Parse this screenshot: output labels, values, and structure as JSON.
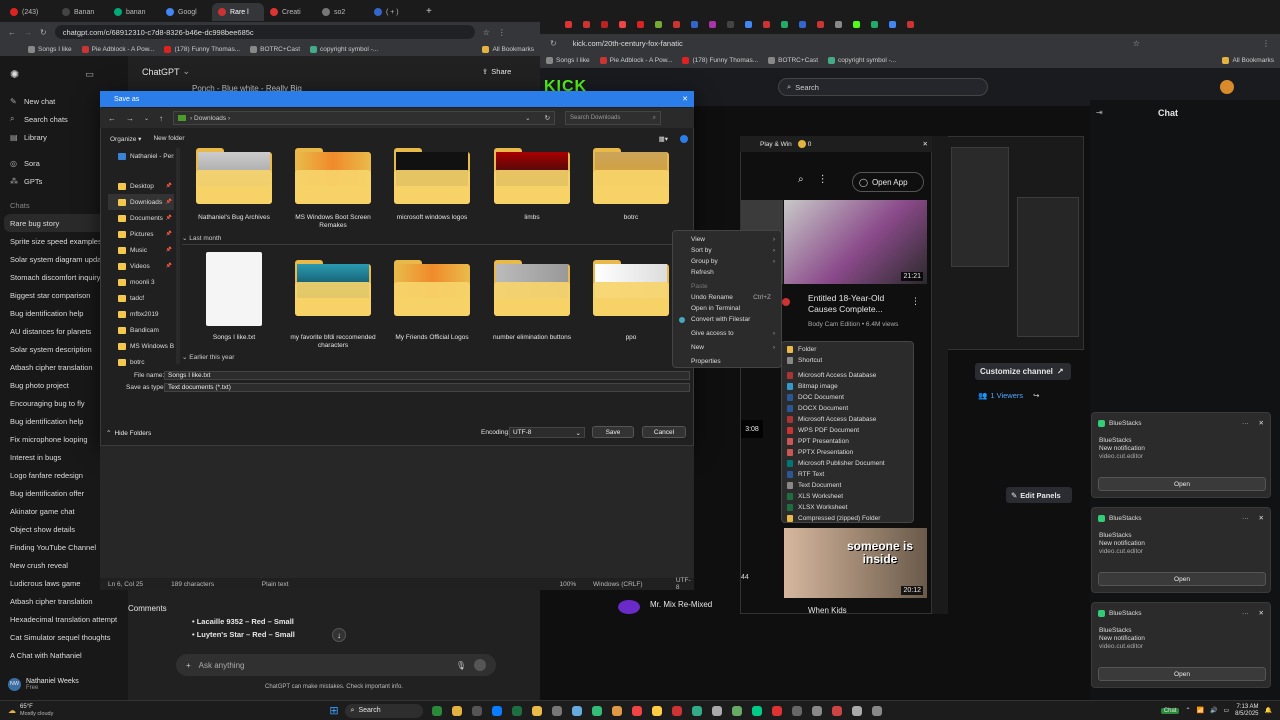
{
  "left_browser": {
    "tabs": [
      "(243)",
      "Banan",
      "banan",
      "Googl",
      "Rare l",
      "Creati",
      "so2",
      "( + )"
    ],
    "url": "chatgpt.com/c/68912310-c7d8-8326-b46e-dc998bee685c",
    "bookmarks": [
      "Songs I like",
      "Pie Adblock - A Pow...",
      "(178) Funny Thomas...",
      "BOTRC+Cast",
      "copyright symbol -..."
    ],
    "all_bookmarks": "All Bookmarks"
  },
  "gpt": {
    "app_title": "ChatGPT",
    "share": "Share",
    "behind_title": "Ponch - Blue white - Really Big",
    "new_chat": "New chat",
    "search_chats": "Search chats",
    "library": "Library",
    "sora": "Sora",
    "gpts": "GPTs",
    "chats_header": "Chats",
    "chats": [
      "Rare bug story",
      "Sprite size speed examples",
      "Solar system diagram updat",
      "Stomach discomfort inquiry",
      "Biggest star comparison",
      "Bug identification help",
      "AU distances for planets",
      "Solar system description",
      "Atbash cipher translation",
      "Bug photo project",
      "Encouraging bug to fly",
      "Bug identification help",
      "Fix microphone looping",
      "Interest in bugs",
      "Logo fanfare redesign",
      "Bug identification offer",
      "Akinator game chat",
      "Object show details",
      "Finding YouTube Channel",
      "New crush reveal",
      "Ludicrous laws game",
      "Atbash cipher translation",
      "Hexadecimal translation attempt",
      "Cat Simulator sequel thoughts",
      "A Chat with Nathaniel"
    ],
    "user_name": "Nathaniel Weeks",
    "user_plan": "Free",
    "user_initials": "NW",
    "comments_label": "Comments",
    "bullets": [
      "Lacaille 9352 – Red – Small",
      "Luyten's Star – Red – Small"
    ],
    "ask_placeholder": "Ask anything",
    "disclaimer": "ChatGPT can make mistakes. Check important info."
  },
  "right_browser": {
    "url": "kick.com/20th-century-fox-fanatic",
    "bookmarks": [
      "Songs I like",
      "Pie Adblock - A Pow...",
      "(178) Funny Thomas...",
      "BOTRC+Cast",
      "copyright symbol -..."
    ],
    "all_bookmarks": "All Bookmarks",
    "search_placeholder": "Search",
    "chat_title": "Chat",
    "customize": "Customize channel",
    "viewers": "1 Viewers",
    "edit_panels": "Edit Panels"
  },
  "youtube": {
    "play_win": "Play & Win",
    "coins": "0",
    "open_app": "Open App",
    "video1_duration": "21:21",
    "video1_title": "Entitled 18-Year-Old Causes Complete...",
    "video1_channel": "Body Cam Edition • 6.4M views",
    "side_duration1": "3:08",
    "side_duration2": "44",
    "video2_overlay": "someone is inside",
    "video2_duration": "20:12",
    "video2_title": "When Kids",
    "mr_mix": "Mr. Mix Re-Mixed"
  },
  "dialog": {
    "title": "Save as",
    "path": "Downloads",
    "search_placeholder": "Search Downloads",
    "organize": "Organize",
    "new_folder": "New folder",
    "nav": [
      "Nathaniel - Pers",
      "Desktop",
      "Downloads",
      "Documents",
      "Pictures",
      "Music",
      "Videos",
      "moonli 3",
      "tadcf",
      "mfbx2019",
      "Bandicam",
      "MS Windows Bc",
      "botrc"
    ],
    "row1": [
      "Nathaniel's Bug Archives",
      "MS Windows Boot Screen Remakes",
      "microsoft windows logos",
      "limbs",
      "botrc"
    ],
    "group_last_month": "Last month",
    "row2": [
      "Songs I like.txt",
      "my favorite bfdi reccomended characters",
      "My Friends Official Logos",
      "number elimination buttons",
      "ppo"
    ],
    "group_earlier": "Earlier this year",
    "file_name_label": "File name:",
    "file_name": "Songs I like.txt",
    "save_type_label": "Save as type:",
    "save_type": "Text documents (*.txt)",
    "hide_folders": "Hide Folders",
    "encoding_label": "Encoding:",
    "encoding": "UTF-8",
    "save": "Save",
    "cancel": "Cancel"
  },
  "notepad_status": {
    "pos": "Ln 6, Col 25",
    "chars": "189 characters",
    "format": "Plain text",
    "zoom": "100%",
    "eol": "Windows (CRLF)",
    "enc": "UTF-8"
  },
  "context_menu": [
    "View",
    "Sort by",
    "Group by",
    "Refresh",
    "Paste",
    "Undo Rename",
    "Open in Terminal",
    "Convert with Filestar",
    "Give access to",
    "New",
    "Properties"
  ],
  "undo_shortcut": "Ctrl+Z",
  "new_submenu": [
    "Folder",
    "Shortcut",
    "Microsoft Access Database",
    "Bitmap image",
    "DOC Document",
    "DOCX Document",
    "Microsoft Access Database",
    "WPS PDF Document",
    "PPT Presentation",
    "PPTX Presentation",
    "Microsoft Publisher Document",
    "RTF Text",
    "Text Document",
    "XLS Worksheet",
    "XLSX Worksheet",
    "Compressed (zipped) Folder"
  ],
  "notifications": [
    {
      "app": "BlueStacks",
      "title": "BlueStacks",
      "body": "New notification",
      "source": "video.cut.editor",
      "action": "Open"
    },
    {
      "app": "BlueStacks",
      "title": "BlueStacks",
      "body": "New notification",
      "source": "video.cut.editor",
      "action": "Open"
    },
    {
      "app": "BlueStacks",
      "title": "BlueStacks",
      "body": "New notification",
      "source": "video.cut.editor",
      "action": "Open"
    }
  ],
  "taskbar": {
    "temp": "65°F",
    "weather": "Mostly cloudy",
    "search": "Search",
    "time": "7:13 AM",
    "date": "8/5/2025",
    "chat_badge": "Chat"
  },
  "colors": {
    "accent_blue": "#2b7de9",
    "kick_green": "#53fc18",
    "folder": "#f2c94c"
  }
}
